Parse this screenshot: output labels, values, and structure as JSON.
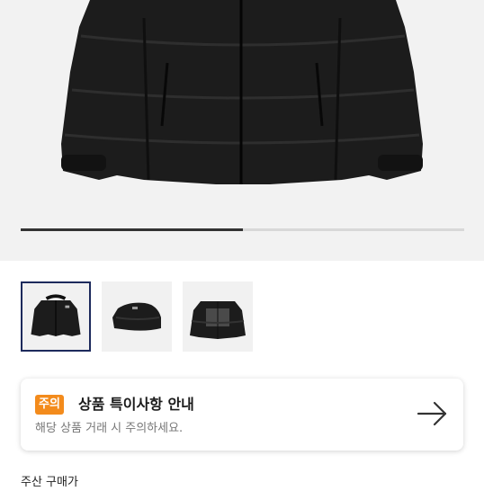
{
  "gallery": {
    "progress_fraction": 0.5,
    "thumbnails": [
      {
        "name": "jacket-front",
        "active": true
      },
      {
        "name": "jacket-side",
        "active": false
      },
      {
        "name": "jacket-back",
        "active": false
      }
    ]
  },
  "notice": {
    "badge": "주의",
    "title": "상품 특이사항 안내",
    "subtitle": "해당 상품 거래 시 주의하세요.",
    "arrow_icon": "arrow-right-icon"
  },
  "footer": {
    "text": "주산 구매가"
  },
  "colors": {
    "badge": "#f38b1c",
    "active_border": "#1d2a5c"
  }
}
